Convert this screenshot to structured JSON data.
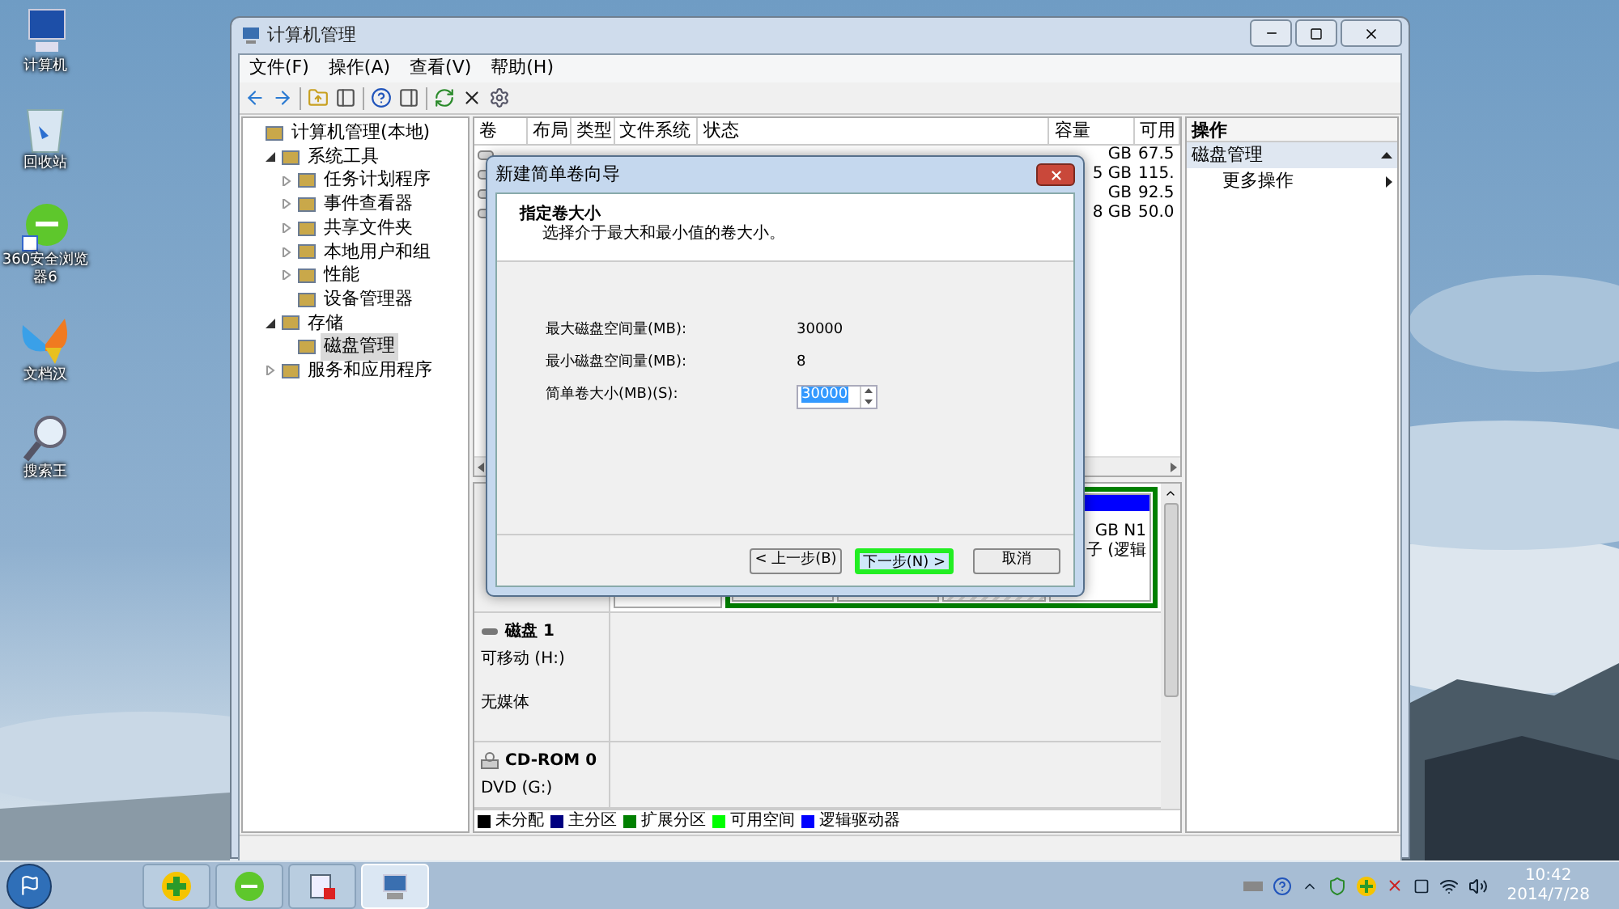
{
  "desktop_icons": [
    {
      "label": "计算机",
      "kind": "computer"
    },
    {
      "label": "回收站",
      "kind": "bin"
    },
    {
      "label": "360安全浏览器6",
      "kind": "browser"
    },
    {
      "label": "文档汉",
      "kind": "butterfly"
    },
    {
      "label": "搜索王",
      "kind": "search"
    }
  ],
  "window": {
    "title": "计算机管理",
    "menu": [
      "文件(F)",
      "操作(A)",
      "查看(V)",
      "帮助(H)"
    ],
    "tree": [
      {
        "label": "计算机管理(本地)",
        "selected": false,
        "children": [
          {
            "label": "系统工具",
            "expanded": true,
            "selected": false,
            "children": [
              {
                "label": "任务计划程序",
                "expanded": false,
                "selected": false
              },
              {
                "label": "事件查看器",
                "expanded": false,
                "selected": false
              },
              {
                "label": "共享文件夹",
                "expanded": false,
                "selected": false
              },
              {
                "label": "本地用户和组",
                "expanded": false,
                "selected": false
              },
              {
                "label": "性能",
                "expanded": false,
                "selected": false
              },
              {
                "label": "设备管理器",
                "selected": false
              }
            ]
          },
          {
            "label": "存储",
            "expanded": true,
            "selected": false,
            "children": [
              {
                "label": "磁盘管理",
                "selected": true
              }
            ]
          },
          {
            "label": "服务和应用程序",
            "expanded": false,
            "selected": false
          }
        ]
      }
    ],
    "volume_columns": [
      "卷",
      "布局",
      "类型",
      "文件系统",
      "状态",
      "容量",
      "可用"
    ],
    "volume_rows": [
      {
        "capacity": "GB",
        "free": "67.5"
      },
      {
        "capacity": "5 GB",
        "free": "115."
      },
      {
        "capacity": "GB",
        "free": "92.5"
      },
      {
        "capacity": "8 GB",
        "free": "50.0"
      }
    ],
    "disk0_partitions": [
      {
        "kind": "primary"
      },
      {
        "kind": "logical"
      },
      {
        "kind": "logical"
      },
      {
        "kind": "free"
      },
      {
        "kind": "logical",
        "lines": [
          "GB N1",
          "子 (逻辑"
        ]
      }
    ],
    "disks": [
      {
        "name": "磁盘 1",
        "kind": "removable",
        "type": "可移动 (H:)",
        "status": "无媒体"
      },
      {
        "name": "CD-ROM 0",
        "kind": "cdrom",
        "type": "DVD (G:)"
      }
    ],
    "legend": [
      {
        "label": "未分配",
        "color": "#000000"
      },
      {
        "label": "主分区",
        "color": "#000080"
      },
      {
        "label": "扩展分区",
        "color": "#008000"
      },
      {
        "label": "可用空间",
        "color": "#00ff00"
      },
      {
        "label": "逻辑驱动器",
        "color": "#0000ff"
      }
    ],
    "actions": {
      "title": "操作",
      "section": "磁盘管理",
      "items": [
        "更多操作"
      ]
    }
  },
  "dialog": {
    "title": "新建简单卷向导",
    "heading": "指定卷大小",
    "subheading": "选择介于最大和最小值的卷大小。",
    "fields": [
      {
        "label": "最大磁盘空间量(MB):",
        "value": "30000",
        "kind": "text"
      },
      {
        "label": "最小磁盘空间量(MB):",
        "value": "8",
        "kind": "text"
      },
      {
        "label": "简单卷大小(MB)(S):",
        "value": "30000",
        "kind": "spin"
      }
    ],
    "buttons": [
      {
        "label": "< 上一步(B)",
        "selected": false
      },
      {
        "label": "下一步(N) >",
        "selected": true
      },
      {
        "label": "取消",
        "selected": false
      }
    ]
  },
  "taskbar": {
    "apps": [
      {
        "kind": "plus",
        "selected": false
      },
      {
        "kind": "browser",
        "selected": false
      },
      {
        "kind": "monitor",
        "selected": false
      },
      {
        "kind": "manage",
        "selected": true
      }
    ],
    "time": "10:42",
    "date": "2014/7/28"
  }
}
